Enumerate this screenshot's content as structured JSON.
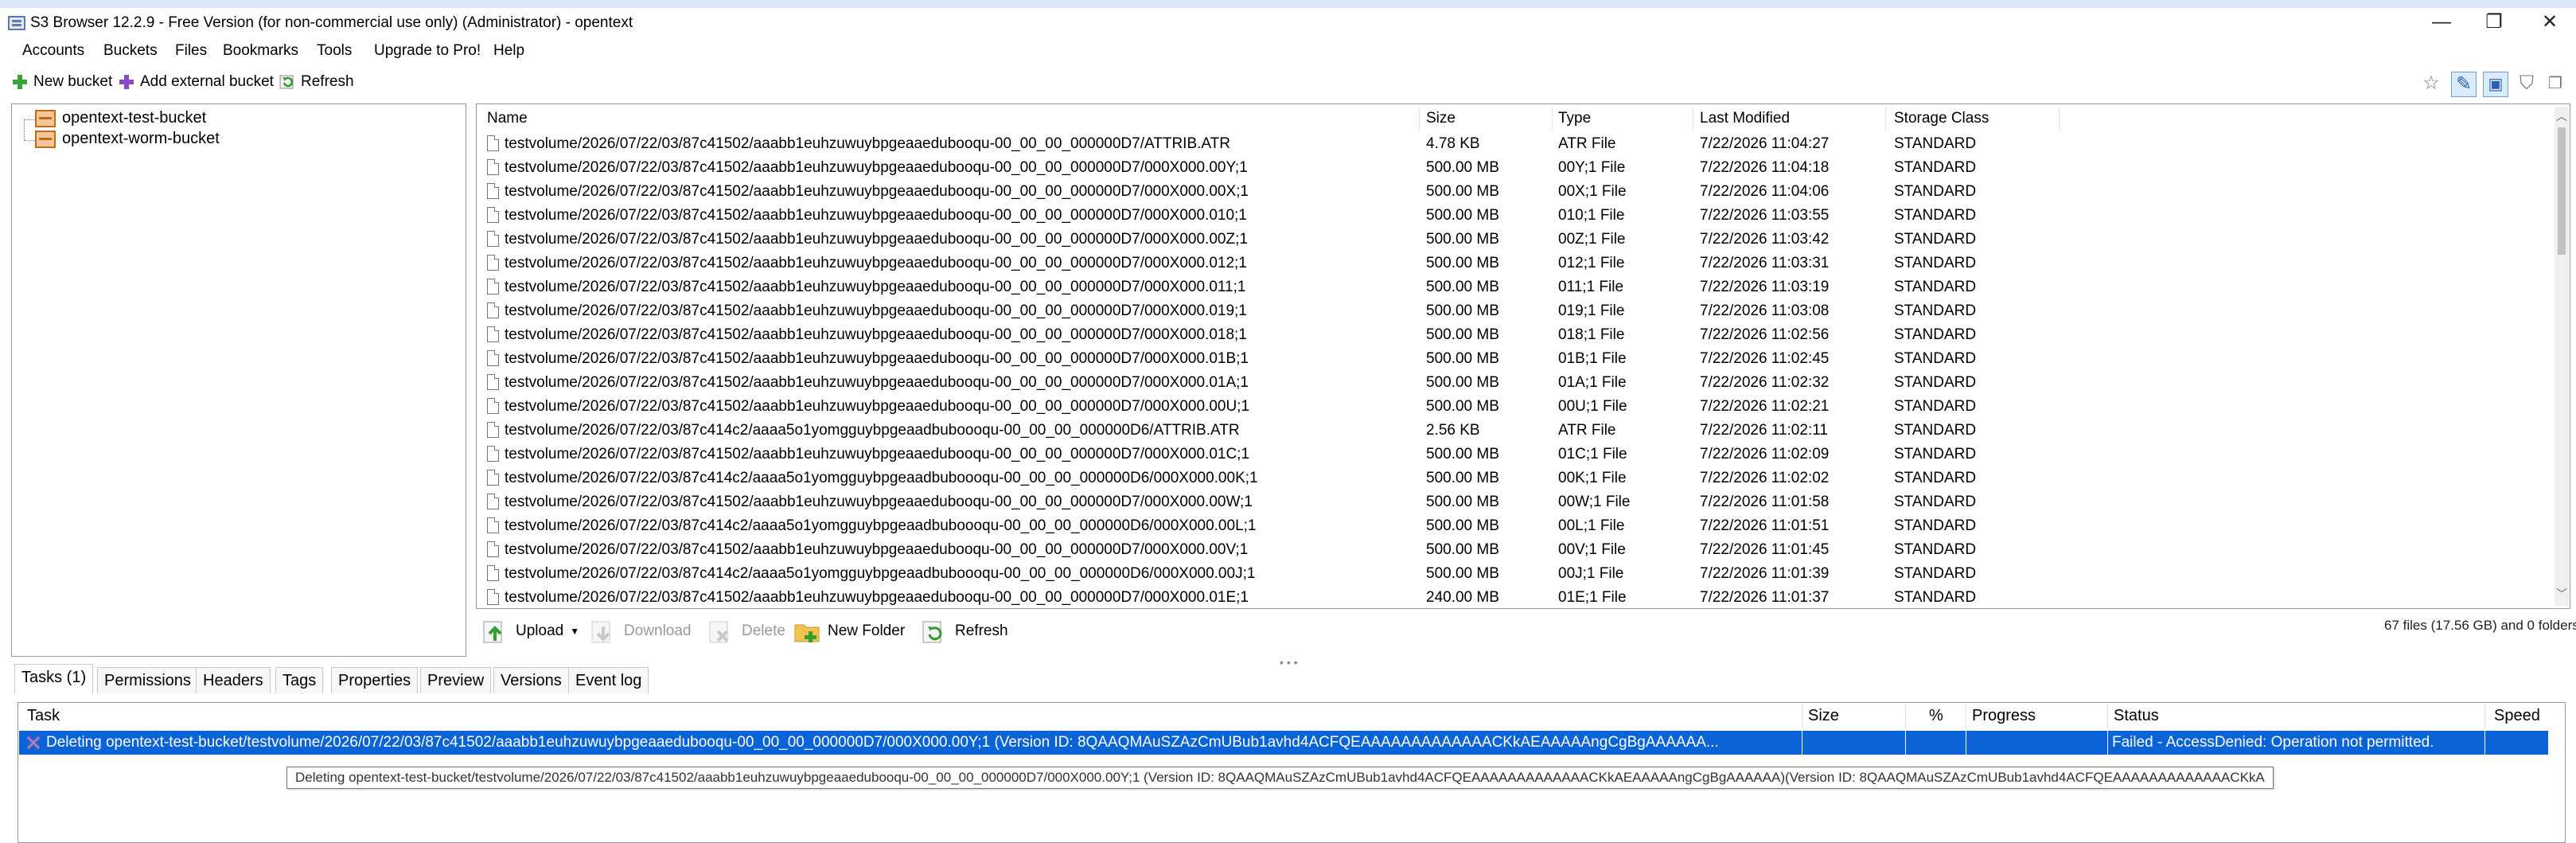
{
  "window": {
    "title": "S3 Browser 12.2.9 - Free Version (for non-commercial use only) (Administrator) - opentext",
    "minimize_glyph": "—",
    "maximize_glyph": "❐",
    "close_glyph": "✕"
  },
  "menu": [
    "Accounts",
    "Buckets",
    "Files",
    "Bookmarks",
    "Tools",
    "Upgrade to Pro!",
    "Help"
  ],
  "toolbar": {
    "new_bucket": "New bucket",
    "add_external_bucket": "Add external bucket",
    "refresh": "Refresh"
  },
  "buckets": [
    "opentext-test-bucket",
    "opentext-worm-bucket"
  ],
  "file_list": {
    "columns": [
      "Name",
      "Size",
      "Type",
      "Last Modified",
      "Storage Class"
    ],
    "rows": [
      [
        "testvolume/2026/07/22/03/87c41502/aaabb1euhzuwuybpgeaaedubooqu-00_00_00_000000D7/ATTRIB.ATR",
        "4.78 KB",
        "ATR File",
        "7/22/2026 11:04:27",
        "STANDARD"
      ],
      [
        "testvolume/2026/07/22/03/87c41502/aaabb1euhzuwuybpgeaaedubooqu-00_00_00_000000D7/000X000.00Y;1",
        "500.00 MB",
        "00Y;1 File",
        "7/22/2026 11:04:18",
        "STANDARD"
      ],
      [
        "testvolume/2026/07/22/03/87c41502/aaabb1euhzuwuybpgeaaedubooqu-00_00_00_000000D7/000X000.00X;1",
        "500.00 MB",
        "00X;1 File",
        "7/22/2026 11:04:06",
        "STANDARD"
      ],
      [
        "testvolume/2026/07/22/03/87c41502/aaabb1euhzuwuybpgeaaedubooqu-00_00_00_000000D7/000X000.010;1",
        "500.00 MB",
        "010;1 File",
        "7/22/2026 11:03:55",
        "STANDARD"
      ],
      [
        "testvolume/2026/07/22/03/87c41502/aaabb1euhzuwuybpgeaaedubooqu-00_00_00_000000D7/000X000.00Z;1",
        "500.00 MB",
        "00Z;1 File",
        "7/22/2026 11:03:42",
        "STANDARD"
      ],
      [
        "testvolume/2026/07/22/03/87c41502/aaabb1euhzuwuybpgeaaedubooqu-00_00_00_000000D7/000X000.012;1",
        "500.00 MB",
        "012;1 File",
        "7/22/2026 11:03:31",
        "STANDARD"
      ],
      [
        "testvolume/2026/07/22/03/87c41502/aaabb1euhzuwuybpgeaaedubooqu-00_00_00_000000D7/000X000.011;1",
        "500.00 MB",
        "011;1 File",
        "7/22/2026 11:03:19",
        "STANDARD"
      ],
      [
        "testvolume/2026/07/22/03/87c41502/aaabb1euhzuwuybpgeaaedubooqu-00_00_00_000000D7/000X000.019;1",
        "500.00 MB",
        "019;1 File",
        "7/22/2026 11:03:08",
        "STANDARD"
      ],
      [
        "testvolume/2026/07/22/03/87c41502/aaabb1euhzuwuybpgeaaedubooqu-00_00_00_000000D7/000X000.018;1",
        "500.00 MB",
        "018;1 File",
        "7/22/2026 11:02:56",
        "STANDARD"
      ],
      [
        "testvolume/2026/07/22/03/87c41502/aaabb1euhzuwuybpgeaaedubooqu-00_00_00_000000D7/000X000.01B;1",
        "500.00 MB",
        "01B;1 File",
        "7/22/2026 11:02:45",
        "STANDARD"
      ],
      [
        "testvolume/2026/07/22/03/87c41502/aaabb1euhzuwuybpgeaaedubooqu-00_00_00_000000D7/000X000.01A;1",
        "500.00 MB",
        "01A;1 File",
        "7/22/2026 11:02:32",
        "STANDARD"
      ],
      [
        "testvolume/2026/07/22/03/87c41502/aaabb1euhzuwuybpgeaaedubooqu-00_00_00_000000D7/000X000.00U;1",
        "500.00 MB",
        "00U;1 File",
        "7/22/2026 11:02:21",
        "STANDARD"
      ],
      [
        "testvolume/2026/07/22/03/87c414c2/aaaa5o1yomgguybpgeaadbuboooqu-00_00_00_000000D6/ATTRIB.ATR",
        "2.56 KB",
        "ATR File",
        "7/22/2026 11:02:11",
        "STANDARD"
      ],
      [
        "testvolume/2026/07/22/03/87c41502/aaabb1euhzuwuybpgeaaedubooqu-00_00_00_000000D7/000X000.01C;1",
        "500.00 MB",
        "01C;1 File",
        "7/22/2026 11:02:09",
        "STANDARD"
      ],
      [
        "testvolume/2026/07/22/03/87c414c2/aaaa5o1yomgguybpgeaadbuboooqu-00_00_00_000000D6/000X000.00K;1",
        "500.00 MB",
        "00K;1 File",
        "7/22/2026 11:02:02",
        "STANDARD"
      ],
      [
        "testvolume/2026/07/22/03/87c41502/aaabb1euhzuwuybpgeaaedubooqu-00_00_00_000000D7/000X000.00W;1",
        "500.00 MB",
        "00W;1 File",
        "7/22/2026 11:01:58",
        "STANDARD"
      ],
      [
        "testvolume/2026/07/22/03/87c414c2/aaaa5o1yomgguybpgeaadbuboooqu-00_00_00_000000D6/000X000.00L;1",
        "500.00 MB",
        "00L;1 File",
        "7/22/2026 11:01:51",
        "STANDARD"
      ],
      [
        "testvolume/2026/07/22/03/87c41502/aaabb1euhzuwuybpgeaaedubooqu-00_00_00_000000D7/000X000.00V;1",
        "500.00 MB",
        "00V;1 File",
        "7/22/2026 11:01:45",
        "STANDARD"
      ],
      [
        "testvolume/2026/07/22/03/87c414c2/aaaa5o1yomgguybpgeaadbuboooqu-00_00_00_000000D6/000X000.00J;1",
        "500.00 MB",
        "00J;1 File",
        "7/22/2026 11:01:39",
        "STANDARD"
      ],
      [
        "testvolume/2026/07/22/03/87c41502/aaabb1euhzuwuybpgeaaedubooqu-00_00_00_000000D7/000X000.01E;1",
        "240.00 MB",
        "01E;1 File",
        "7/22/2026 11:01:37",
        "STANDARD"
      ]
    ]
  },
  "actions": {
    "upload": "Upload",
    "download": "Download",
    "delete": "Delete",
    "new_folder": "New Folder",
    "refresh": "Refresh"
  },
  "summary": "67 files (17.56 GB) and 0 folders",
  "tabs": [
    "Tasks (1)",
    "Permissions",
    "Headers",
    "Tags",
    "Properties",
    "Preview",
    "Versions",
    "Event log"
  ],
  "tasks": {
    "columns": [
      "Task",
      "Size",
      "%",
      "Progress",
      "Status",
      "Speed"
    ],
    "row": {
      "task": "Deleting opentext-test-bucket/testvolume/2026/07/22/03/87c41502/aaabb1euhzuwuybpgeaaedubooqu-00_00_00_000000D7/000X000.00Y;1 (Version ID: 8QAAQMAuSZAzCmUBub1avhd4ACFQEAAAAAAAAAAAAACKkAEAAAAAngCgBgAAAAAA...",
      "status": "Failed - AccessDenied: Operation not permitted."
    },
    "tooltip": "Deleting opentext-test-bucket/testvolume/2026/07/22/03/87c41502/aaabb1euhzuwuybpgeaaedubooqu-00_00_00_000000D7/000X000.00Y;1 (Version ID: 8QAAQMAuSZAzCmUBub1avhd4ACFQEAAAAAAAAAAAAACKkAEAAAAAngCgBgAAAAAA)(Version ID: 8QAAQMAuSZAzCmUBub1avhd4ACFQEAAAAAAAAAAAAACKkA"
  },
  "colors": {
    "selection": "#0a64d8",
    "failed_icon": "#6a5aa8",
    "bucket_fill": "#f3c69a",
    "bucket_border": "#c06b1c"
  }
}
